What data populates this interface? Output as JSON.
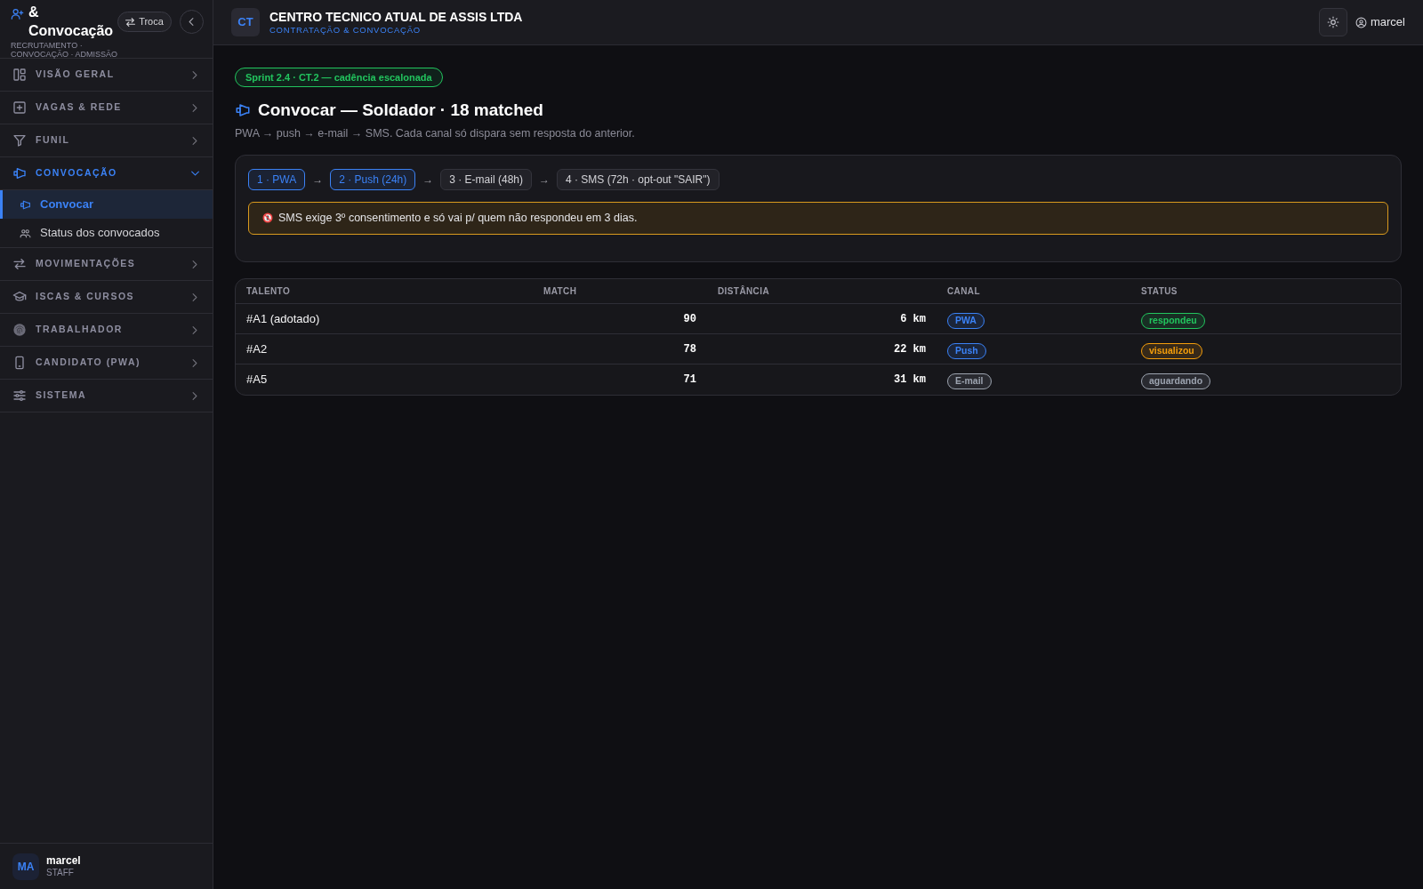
{
  "sidebar": {
    "title": "& Convocação",
    "subtitle": "RECRUTAMENTO · CONVOCAÇÃO · ADMISSÃO",
    "switch_button": "Troca",
    "nav": [
      {
        "label": "VISÃO GERAL",
        "expanded": false
      },
      {
        "label": "VAGAS & REDE",
        "expanded": false
      },
      {
        "label": "FUNIL",
        "expanded": false
      },
      {
        "label": "CONVOCAÇÃO",
        "expanded": true,
        "children": [
          {
            "label": "Convocar",
            "selected": true
          },
          {
            "label": "Status dos convocados",
            "selected": false
          }
        ]
      },
      {
        "label": "MOVIMENTAÇÕES",
        "expanded": false
      },
      {
        "label": "ISCAS & CURSOS",
        "expanded": false
      },
      {
        "label": "TRABALHADOR",
        "expanded": false
      },
      {
        "label": "CANDIDATO (PWA)",
        "expanded": false
      },
      {
        "label": "SISTEMA",
        "expanded": false
      }
    ],
    "user": {
      "initials": "MA",
      "name": "marcel",
      "role": "STAFF"
    }
  },
  "header": {
    "org_initials": "CT",
    "org_name": "CENTRO TECNICO ATUAL DE ASSIS LTDA",
    "module": "CONTRATAÇÃO & CONVOCAÇÃO",
    "user": "marcel"
  },
  "page": {
    "badge": "Sprint 2.4 · CT.2 — cadência escalonada",
    "title": "Convocar — Soldador · 18 matched",
    "subtitle": "PWA → push → e-mail → SMS. Cada canal só dispara sem resposta do anterior."
  },
  "cadence": {
    "steps": [
      {
        "label": "1 · PWA",
        "active": true
      },
      {
        "label": "2 · Push (24h)",
        "active": true
      },
      {
        "label": "3 · E-mail (48h)",
        "active": false
      },
      {
        "label": "4 · SMS (72h · opt-out \"SAIR\")",
        "active": false
      }
    ],
    "arrows": [
      "→",
      "→",
      "→"
    ],
    "notice": "SMS exige 3º consentimento e só vai p/ quem não respondeu em 3 dias."
  },
  "table": {
    "columns": [
      "TALENTO",
      "MATCH",
      "DISTÂNCIA",
      "CANAL",
      "STATUS"
    ],
    "rows": [
      {
        "talent": "#A1 (adotado)",
        "match": "90",
        "distance": "6 km",
        "channel": {
          "label": "PWA",
          "color": "#3b82f6"
        },
        "status": {
          "label": "respondeu",
          "color": "#22c55e"
        }
      },
      {
        "talent": "#A2",
        "match": "78",
        "distance": "22 km",
        "channel": {
          "label": "Push",
          "color": "#3b82f6"
        },
        "status": {
          "label": "visualizou",
          "color": "#f59e0b"
        }
      },
      {
        "talent": "#A5",
        "match": "71",
        "distance": "31 km",
        "channel": {
          "label": "E-mail",
          "color": "#9ca3af"
        },
        "status": {
          "label": "aguardando",
          "color": "#9ca3af"
        }
      }
    ]
  }
}
